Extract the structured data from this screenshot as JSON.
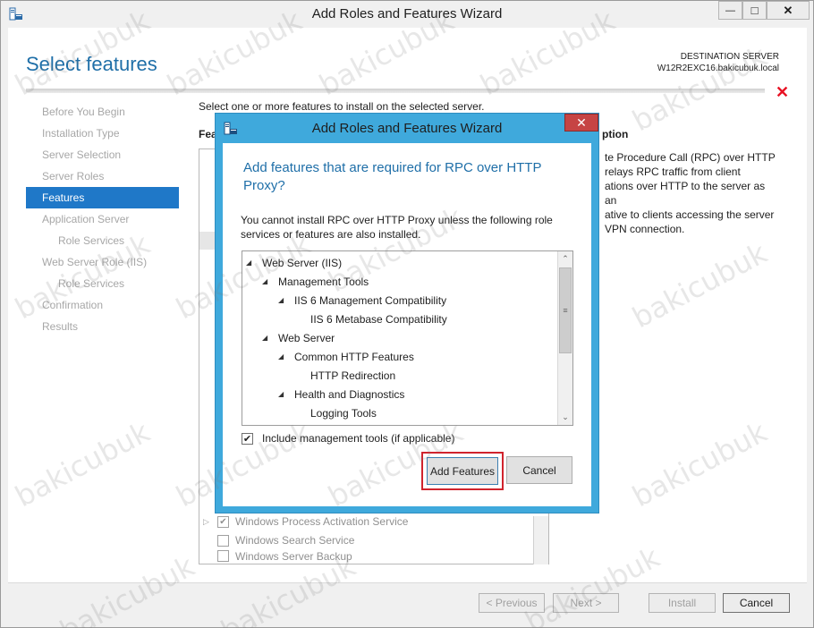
{
  "window": {
    "title": "Add Roles and Features Wizard",
    "minimize_glyph": "—",
    "maximize_glyph": "□",
    "close_glyph": "✕"
  },
  "header": {
    "page_title": "Select features",
    "destination_label": "DESTINATION SERVER",
    "destination_value": "W12R2EXC16.bakicubuk.local",
    "dismiss_glyph": "✕"
  },
  "nav": {
    "items": [
      {
        "label": "Before You Begin"
      },
      {
        "label": "Installation Type"
      },
      {
        "label": "Server Selection"
      },
      {
        "label": "Server Roles"
      },
      {
        "label": "Features"
      },
      {
        "label": "Application Server"
      },
      {
        "label": "Role Services"
      },
      {
        "label": "Web Server Role (IIS)"
      },
      {
        "label": "Role Services"
      },
      {
        "label": "Confirmation"
      },
      {
        "label": "Results"
      }
    ]
  },
  "main": {
    "intro": "Select one or more features to install on the selected server.",
    "features_heading": "Fea",
    "description_heading": "ption",
    "description_lines": [
      "te Procedure Call (RPC) over HTTP",
      "relays RPC traffic from client",
      "ations over HTTP to the server as an",
      "ative to clients accessing the server",
      "VPN connection."
    ],
    "feature_rows": [
      {
        "label": "Windows Process Activation Service",
        "expander": "▷",
        "check": "✔"
      },
      {
        "label": "Windows Search Service",
        "expander": "",
        "check": ""
      },
      {
        "label": "Windows Server Backup",
        "expander": "",
        "check": ""
      }
    ]
  },
  "footer": {
    "previous": "< Previous",
    "next": "Next >",
    "install": "Install",
    "cancel": "Cancel"
  },
  "dialog": {
    "title": "Add Roles and Features Wizard",
    "close_glyph": "✕",
    "heading": "Add features that are required for RPC over HTTP Proxy?",
    "message": "You cannot install RPC over HTTP Proxy unless the following role services or features are also installed.",
    "tree": [
      {
        "label": "Web Server (IIS)",
        "toggle": "◢"
      },
      {
        "label": "Management Tools",
        "toggle": "◢"
      },
      {
        "label": "IIS 6 Management Compatibility",
        "toggle": "◢"
      },
      {
        "label": "IIS 6 Metabase Compatibility",
        "toggle": ""
      },
      {
        "label": "Web Server",
        "toggle": "◢"
      },
      {
        "label": "Common HTTP Features",
        "toggle": "◢"
      },
      {
        "label": "HTTP Redirection",
        "toggle": ""
      },
      {
        "label": "Health and Diagnostics",
        "toggle": "◢"
      },
      {
        "label": "Logging Tools",
        "toggle": ""
      }
    ],
    "scroll_up": "⌃",
    "scroll_down": "⌄",
    "scroll_grip": "≡",
    "include_label": "Include management tools (if applicable)",
    "include_check": "✔",
    "add_features": "Add Features",
    "cancel": "Cancel"
  },
  "watermark": "bakicubuk"
}
